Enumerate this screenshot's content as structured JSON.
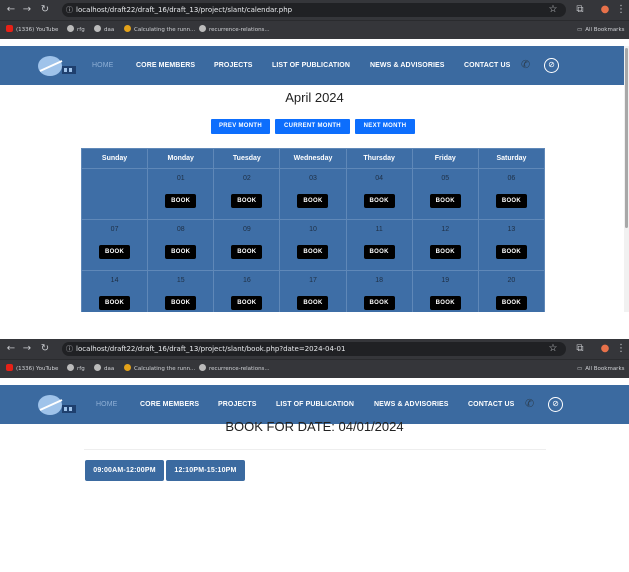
{
  "browser_calendar": {
    "url": "localhost/draft22/draft_16/draft_13/project/slant/calendar.php",
    "bookmarks": [
      "(1336) YouTube",
      "rfg",
      "daa",
      "Calculating the runn...",
      "recurrence-relations..."
    ],
    "all_bookmarks": "All Bookmarks"
  },
  "browser_book": {
    "url": "localhost/draft22/draft_16/draft_13/project/slant/book.php?date=2024-04-01",
    "bookmarks": [
      "(1336) YouTube",
      "rfg",
      "daa",
      "Calculating the runn...",
      "recurrence-relations..."
    ],
    "all_bookmarks": "All Bookmarks"
  },
  "nav": {
    "home": "HOME",
    "core_members": "CORE MEMBERS",
    "projects": "PROJECTS",
    "publications": "LIST OF PUBLICATION",
    "news": "NEWS & ADVISORIES",
    "contact": "CONTACT US"
  },
  "calendar": {
    "title": "April 2024",
    "prev": "PREV MONTH",
    "current": "CURRENT MONTH",
    "next": "NEXT MONTH",
    "weekdays": [
      "Sunday",
      "Monday",
      "Tuesday",
      "Wednesday",
      "Thursday",
      "Friday",
      "Saturday"
    ],
    "book_label": "BOOK",
    "weeks": [
      [
        "",
        "01",
        "02",
        "03",
        "04",
        "05",
        "06"
      ],
      [
        "07",
        "08",
        "09",
        "10",
        "11",
        "12",
        "13"
      ],
      [
        "14",
        "15",
        "16",
        "17",
        "18",
        "19",
        "20"
      ]
    ]
  },
  "booking": {
    "title": "BOOK FOR DATE: 04/01/2024",
    "slots": [
      "09:00AM-12:00PM",
      "12:10PM-15:10PM"
    ]
  },
  "colors": {
    "nav_bg": "#3b6aa0",
    "calendar_bg": "#3e6ea6",
    "button_blue": "#0d6efd",
    "book_btn": "#000000"
  }
}
